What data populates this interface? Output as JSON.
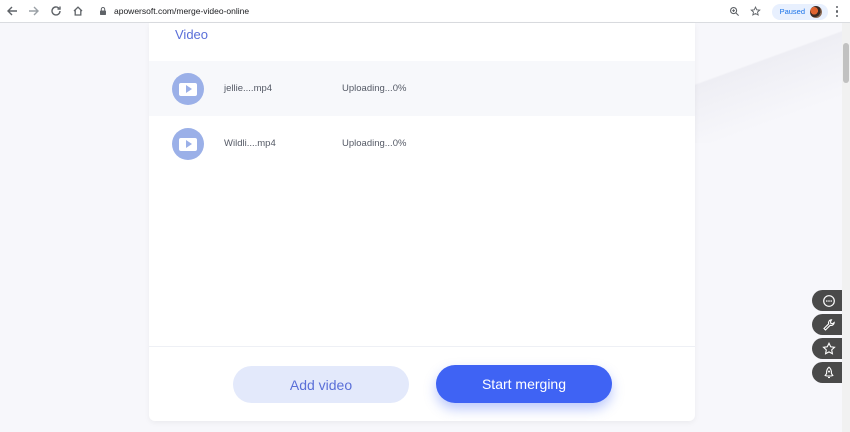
{
  "browser": {
    "url": "apowersoft.com/merge-video-online",
    "profile_status": "Paused",
    "icons": [
      "back-icon",
      "forward-icon",
      "reload-icon",
      "home-icon",
      "lock-icon",
      "zoom-icon",
      "bookmark-star-icon",
      "menu-icon"
    ]
  },
  "card": {
    "title": "Video",
    "files": [
      {
        "name": "jellie....mp4",
        "status": "Uploading...0%"
      },
      {
        "name": "Wildli....mp4",
        "status": "Uploading...0%"
      }
    ],
    "add_label": "Add video",
    "merge_label": "Start merging"
  },
  "side_tools": [
    "chat-icon",
    "wrench-icon",
    "star-icon",
    "rocket-icon"
  ],
  "colors": {
    "accent": "#3f63f4",
    "title": "#5a6fd8",
    "add_button_bg": "#e3e9fb",
    "video_icon": "#9bb0e8"
  }
}
